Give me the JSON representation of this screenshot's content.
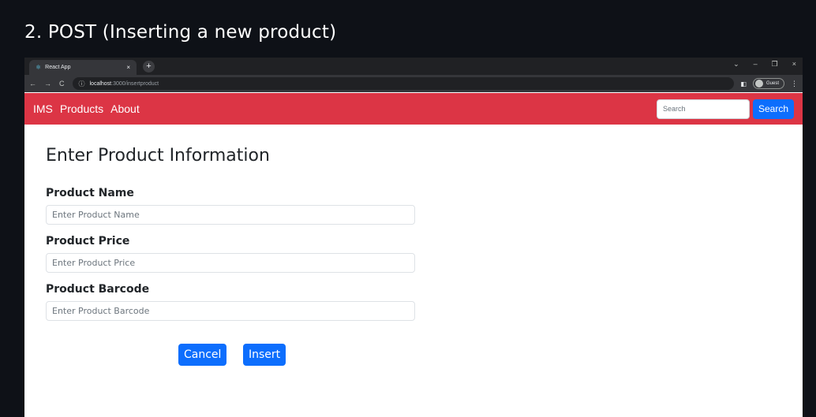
{
  "slide": {
    "title": "2. POST (Inserting a new product)"
  },
  "browser": {
    "tab": {
      "title": "React App",
      "favicon": "react-icon",
      "close": "×"
    },
    "new_tab": "+",
    "window_controls": {
      "tabs_menu": "⌄",
      "minimize": "–",
      "restore": "❐",
      "close": "×"
    },
    "toolbar": {
      "back": "←",
      "forward": "→",
      "reload": "C",
      "info_icon": "ⓘ",
      "url_host": "localhost",
      "url_path": ":3000/insertproduct",
      "side_panel_icon": "◧",
      "profile_label": "Guest",
      "menu_icon": "⋮"
    }
  },
  "navbar": {
    "brand": "IMS",
    "links": [
      "Products",
      "About"
    ],
    "search_placeholder": "Search",
    "search_button": "Search",
    "color": "#dc3545"
  },
  "form": {
    "heading": "Enter Product Information",
    "fields": [
      {
        "label": "Product Name",
        "placeholder": "Enter Product Name",
        "value": ""
      },
      {
        "label": "Product Price",
        "placeholder": "Enter Product Price",
        "value": ""
      },
      {
        "label": "Product Barcode",
        "placeholder": "Enter Product Barcode",
        "value": ""
      }
    ],
    "cancel_label": "Cancel",
    "insert_label": "Insert",
    "button_color": "#0d6efd"
  }
}
